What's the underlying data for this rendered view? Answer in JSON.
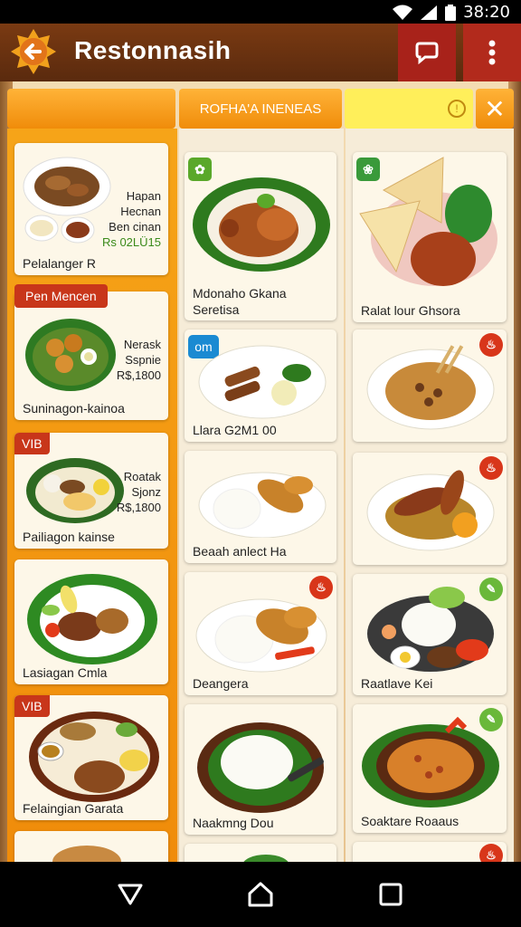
{
  "status_bar": {
    "time": "38:20"
  },
  "app_bar": {
    "title": "Restonnasih"
  },
  "tabs": {
    "middle_label": "ROFHA'A INENEAS"
  },
  "search": {
    "value": "",
    "placeholder": ""
  },
  "left_column": {
    "cards": [
      {
        "label": "Pelalanger R",
        "price_lines": [
          "Hapan",
          "Hecnan",
          "Ben cinan",
          "Rs 02LÜ15"
        ]
      },
      {
        "label": "Suninagon-kainoa",
        "badge": "Pen Mencen",
        "price_lines": [
          "Nerask",
          "Sspnie",
          "R$,1800"
        ]
      },
      {
        "label": "Pailiagon kainse",
        "badge": "VIB",
        "price_lines": [
          "Roatak",
          "Sjonz",
          "R$,1800"
        ]
      },
      {
        "label": "Lasiagan Cmla"
      },
      {
        "label": "Felaingian Garata",
        "badge": "VIB"
      },
      {
        "label": ""
      }
    ]
  },
  "middle_column": {
    "cards": [
      {
        "label_line1": "Mdonaho Gkana",
        "label_line2": "Seretisa",
        "icon": "leaf-icon"
      },
      {
        "label": "Llara G2M1 00",
        "badge": "om"
      },
      {
        "label": "Beaah anlect Ha"
      },
      {
        "label": "Deangera",
        "icon": "fire-icon"
      },
      {
        "label": "Naakmng Dou"
      },
      {
        "label": ""
      }
    ]
  },
  "right_column": {
    "cards": [
      {
        "label": "Ralat lour Ghsora",
        "icon": "plant-icon"
      },
      {
        "label": "",
        "icon": "fire-icon"
      },
      {
        "label": "",
        "icon": "fire-icon"
      },
      {
        "label": "Raatlave Kei",
        "icon": "leaf-icon"
      },
      {
        "label": "Soaktare Roaaus",
        "icon": "leaf-icon"
      },
      {
        "label": "",
        "icon": "fire-icon"
      }
    ]
  },
  "colors": {
    "orange": "#f39a12",
    "red": "#c8361a",
    "green": "#5aa82a",
    "app_bar": "#6a3212"
  }
}
